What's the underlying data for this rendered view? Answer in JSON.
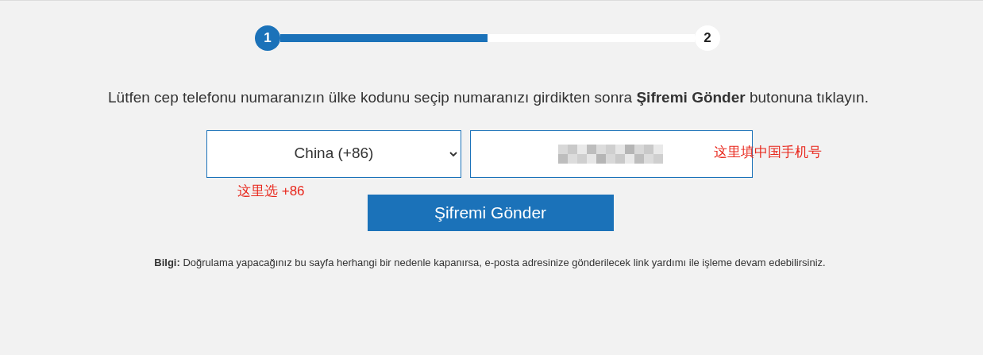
{
  "stepper": {
    "steps": [
      {
        "label": "1",
        "selected": true
      },
      {
        "label": "2",
        "selected": false
      }
    ],
    "level": 0.5
  },
  "instruction": "Lütfen cep telefonu numaranızın ülke kodunu seçip numaranızı girdikten sonra **Şifremi Gönder** butonuna tıklayın.",
  "country_select": {
    "value": "China (+86)"
  },
  "phone_field": {
    "redacted": true
  },
  "annotations": [
    {
      "text": "这里选 +86",
      "color": "#e8261b"
    },
    {
      "text": "这里填中国手机号",
      "color": "#e8261b"
    }
  ],
  "submit_button": "Şifremi Gönder",
  "info": "**Bilgi:** Doğrulama yapacağınız bu sayfa herhangi bir nedenle kapanırsa, e-posta adresinize gönderilecek link yardımı ile işleme devam edebilirsiniz."
}
